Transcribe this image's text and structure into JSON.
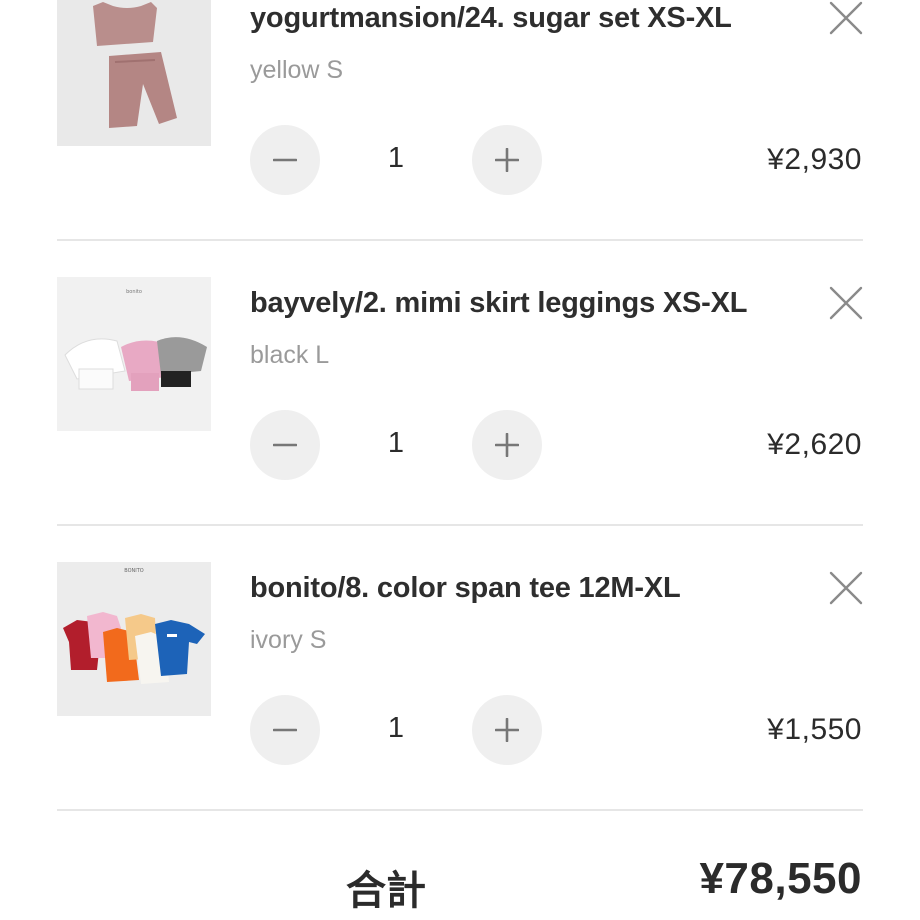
{
  "cart": {
    "items": [
      {
        "title": "yogurtmansion/24. sugar set XS-XL",
        "variant": "yellow S",
        "quantity": "1",
        "price": "¥2,930",
        "image_icon": "product-photo-pink-set"
      },
      {
        "title": "bayvely/2. mimi skirt leggings XS-XL",
        "variant": "black L",
        "quantity": "1",
        "price": "¥2,620",
        "image_icon": "product-photo-skirt-leggings"
      },
      {
        "title": "bonito/8. color span tee 12M-XL",
        "variant": "ivory S",
        "quantity": "1",
        "price": "¥1,550",
        "image_icon": "product-photo-color-tees"
      }
    ],
    "total_label": "合計",
    "total_value": "¥78,550"
  },
  "thumb_texts": {
    "bayvely_brand": "bonito",
    "bonito_brand": "BONITO"
  },
  "icons": {
    "remove": "close-icon",
    "decrease": "minus-icon",
    "increase": "plus-icon"
  },
  "colors": {
    "text": "#2b2b2b",
    "variant_text": "#9a9a9a",
    "button_bg": "#efefef",
    "divider": "#e6e6e6"
  }
}
